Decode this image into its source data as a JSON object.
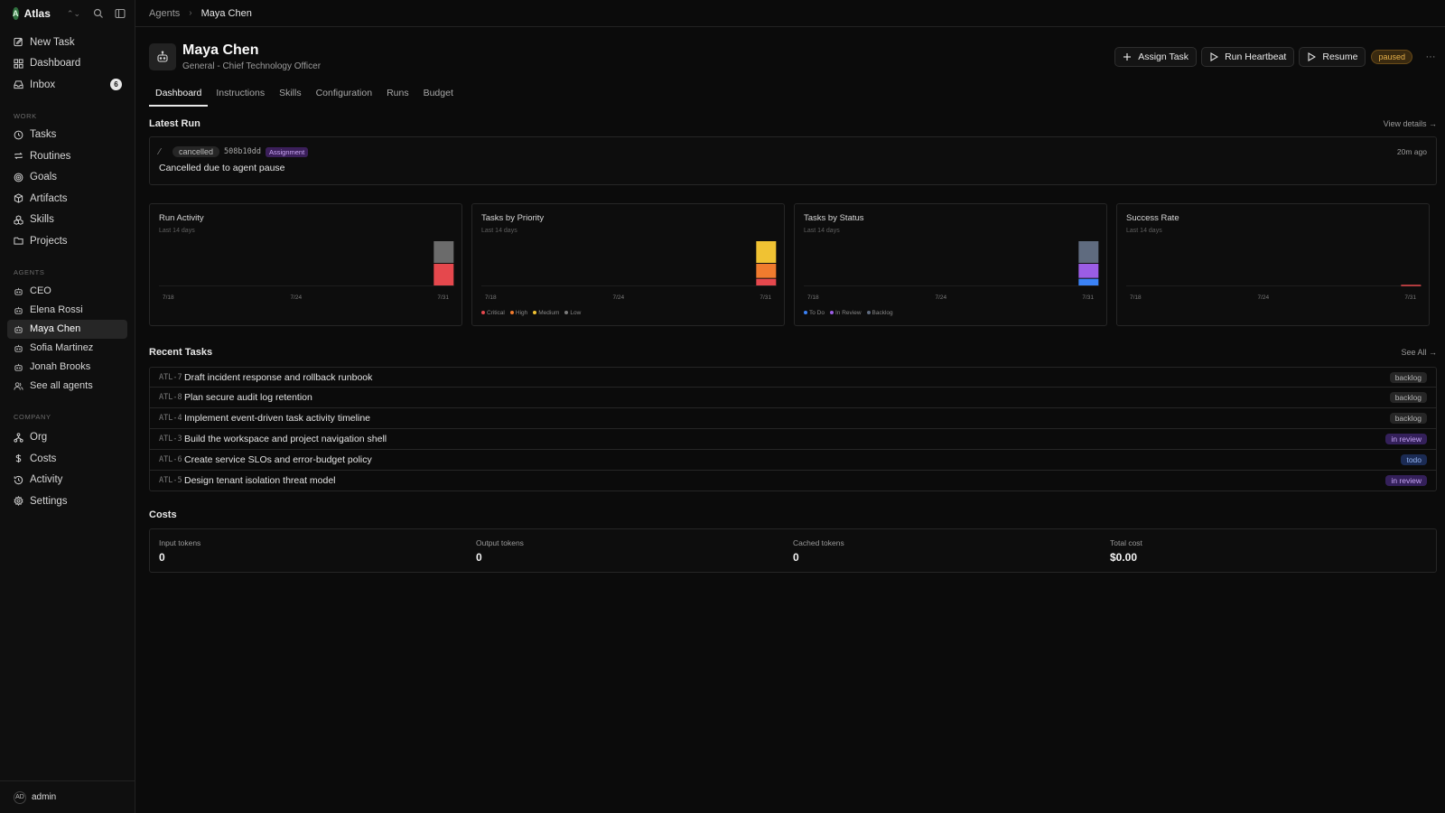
{
  "workspace": {
    "name": "Atlas",
    "initial": "A"
  },
  "sidebar": {
    "main": [
      {
        "label": "New Task",
        "icon": "edit-icon"
      },
      {
        "label": "Dashboard",
        "icon": "dashboard-icon"
      },
      {
        "label": "Inbox",
        "icon": "inbox-icon",
        "count": "6"
      }
    ],
    "work_label": "WORK",
    "work": [
      {
        "label": "Tasks"
      },
      {
        "label": "Routines"
      },
      {
        "label": "Goals"
      },
      {
        "label": "Artifacts"
      },
      {
        "label": "Skills"
      },
      {
        "label": "Projects"
      }
    ],
    "agents_label": "AGENTS",
    "agents": [
      {
        "label": "CEO"
      },
      {
        "label": "Elena Rossi"
      },
      {
        "label": "Maya Chen"
      },
      {
        "label": "Sofia Martinez"
      },
      {
        "label": "Jonah Brooks"
      },
      {
        "label": "See all agents"
      }
    ],
    "company_label": "COMPANY",
    "company": [
      {
        "label": "Org"
      },
      {
        "label": "Costs"
      },
      {
        "label": "Activity"
      },
      {
        "label": "Settings"
      }
    ],
    "user": {
      "initials": "AD",
      "name": "admin"
    }
  },
  "breadcrumb": {
    "parent": "Agents",
    "current": "Maya Chen"
  },
  "agent": {
    "name": "Maya Chen",
    "subtitle": "General - Chief Technology Officer",
    "status": "paused"
  },
  "actions": {
    "assign": "Assign Task",
    "heartbeat": "Run Heartbeat",
    "resume": "Resume",
    "more": "···"
  },
  "tabs": [
    "Dashboard",
    "Instructions",
    "Skills",
    "Configuration",
    "Runs",
    "Budget"
  ],
  "latest_run": {
    "title": "Latest Run",
    "view_details": "View details →",
    "status": "cancelled",
    "id": "508b10dd",
    "tag": "Assignment",
    "time": "20m ago",
    "message": "Cancelled due to agent pause"
  },
  "charts": [
    {
      "title": "Run Activity",
      "subtitle": "Last 14 days",
      "chart_data": {
        "type": "bar",
        "stacked": true,
        "categories": [
          "7/18",
          "7/19",
          "7/20",
          "7/21",
          "7/22",
          "7/23",
          "7/24",
          "7/25",
          "7/26",
          "7/27",
          "7/28",
          "7/29",
          "7/30",
          "7/31"
        ],
        "x_ticks": [
          "7/18",
          "7/24",
          "7/31"
        ],
        "series": [
          {
            "color": "#e5484d",
            "values": [
              0,
              0,
              0,
              0,
              0,
              0,
              0,
              0,
              0,
              0,
              0,
              0,
              0,
              1
            ]
          },
          {
            "color": "#6b6b6b",
            "values": [
              0,
              0,
              0,
              0,
              0,
              0,
              0,
              0,
              0,
              0,
              0,
              0,
              0,
              1
            ]
          }
        ]
      },
      "legend": []
    },
    {
      "title": "Tasks by Priority",
      "subtitle": "Last 14 days",
      "chart_data": {
        "type": "bar",
        "stacked": true,
        "categories": [
          "7/18",
          "7/19",
          "7/20",
          "7/21",
          "7/22",
          "7/23",
          "7/24",
          "7/25",
          "7/26",
          "7/27",
          "7/28",
          "7/29",
          "7/30",
          "7/31"
        ],
        "x_ticks": [
          "7/18",
          "7/24",
          "7/31"
        ],
        "series": [
          {
            "name": "Critical",
            "color": "#e5484d",
            "values": [
              0,
              0,
              0,
              0,
              0,
              0,
              0,
              0,
              0,
              0,
              0,
              0,
              0,
              1
            ]
          },
          {
            "name": "High",
            "color": "#f07b2e",
            "values": [
              0,
              0,
              0,
              0,
              0,
              0,
              0,
              0,
              0,
              0,
              0,
              0,
              0,
              2
            ]
          },
          {
            "name": "Medium",
            "color": "#f0c233",
            "values": [
              0,
              0,
              0,
              0,
              0,
              0,
              0,
              0,
              0,
              0,
              0,
              0,
              0,
              3
            ]
          },
          {
            "name": "Low",
            "color": "#7a7a7a",
            "values": [
              0,
              0,
              0,
              0,
              0,
              0,
              0,
              0,
              0,
              0,
              0,
              0,
              0,
              0
            ]
          }
        ]
      },
      "legend": [
        {
          "label": "Critical",
          "color": "#e5484d"
        },
        {
          "label": "High",
          "color": "#f07b2e"
        },
        {
          "label": "Medium",
          "color": "#f0c233"
        },
        {
          "label": "Low",
          "color": "#7a7a7a"
        }
      ]
    },
    {
      "title": "Tasks by Status",
      "subtitle": "Last 14 days",
      "chart_data": {
        "type": "bar",
        "stacked": true,
        "categories": [
          "7/18",
          "7/19",
          "7/20",
          "7/21",
          "7/22",
          "7/23",
          "7/24",
          "7/25",
          "7/26",
          "7/27",
          "7/28",
          "7/29",
          "7/30",
          "7/31"
        ],
        "x_ticks": [
          "7/18",
          "7/24",
          "7/31"
        ],
        "series": [
          {
            "name": "To Do",
            "color": "#3b82f6",
            "values": [
              0,
              0,
              0,
              0,
              0,
              0,
              0,
              0,
              0,
              0,
              0,
              0,
              0,
              1
            ]
          },
          {
            "name": "In Review",
            "color": "#9b5de5",
            "values": [
              0,
              0,
              0,
              0,
              0,
              0,
              0,
              0,
              0,
              0,
              0,
              0,
              0,
              2
            ]
          },
          {
            "name": "Backlog",
            "color": "#5f6b7f",
            "values": [
              0,
              0,
              0,
              0,
              0,
              0,
              0,
              0,
              0,
              0,
              0,
              0,
              0,
              3
            ]
          }
        ]
      },
      "legend": [
        {
          "label": "To Do",
          "color": "#3b82f6"
        },
        {
          "label": "In Review",
          "color": "#9b5de5"
        },
        {
          "label": "Backlog",
          "color": "#5f6b7f"
        }
      ]
    },
    {
      "title": "Success Rate",
      "subtitle": "Last 14 days",
      "chart_data": {
        "type": "bar",
        "categories": [
          "7/18",
          "7/19",
          "7/20",
          "7/21",
          "7/22",
          "7/23",
          "7/24",
          "7/25",
          "7/26",
          "7/27",
          "7/28",
          "7/29",
          "7/30",
          "7/31"
        ],
        "x_ticks": [
          "7/18",
          "7/24",
          "7/31"
        ],
        "series": [
          {
            "color": "#e5484d",
            "values": [
              0,
              0,
              0,
              0,
              0,
              0,
              0,
              0,
              0,
              0,
              0,
              0,
              0,
              0
            ]
          }
        ]
      },
      "legend": []
    }
  ],
  "recent_tasks": {
    "title": "Recent Tasks",
    "see_all": "See All →",
    "items": [
      {
        "id": "ATL-7",
        "title": "Draft incident response and rollback runbook",
        "status": "backlog"
      },
      {
        "id": "ATL-8",
        "title": "Plan secure audit log retention",
        "status": "backlog"
      },
      {
        "id": "ATL-4",
        "title": "Implement event-driven task activity timeline",
        "status": "backlog"
      },
      {
        "id": "ATL-3",
        "title": "Build the workspace and project navigation shell",
        "status": "in review"
      },
      {
        "id": "ATL-6",
        "title": "Create service SLOs and error-budget policy",
        "status": "todo"
      },
      {
        "id": "ATL-5",
        "title": "Design tenant isolation threat model",
        "status": "in review"
      }
    ]
  },
  "costs": {
    "title": "Costs",
    "items": [
      {
        "label": "Input tokens",
        "value": "0"
      },
      {
        "label": "Output tokens",
        "value": "0"
      },
      {
        "label": "Cached tokens",
        "value": "0"
      },
      {
        "label": "Total cost",
        "value": "$0.00"
      }
    ]
  }
}
